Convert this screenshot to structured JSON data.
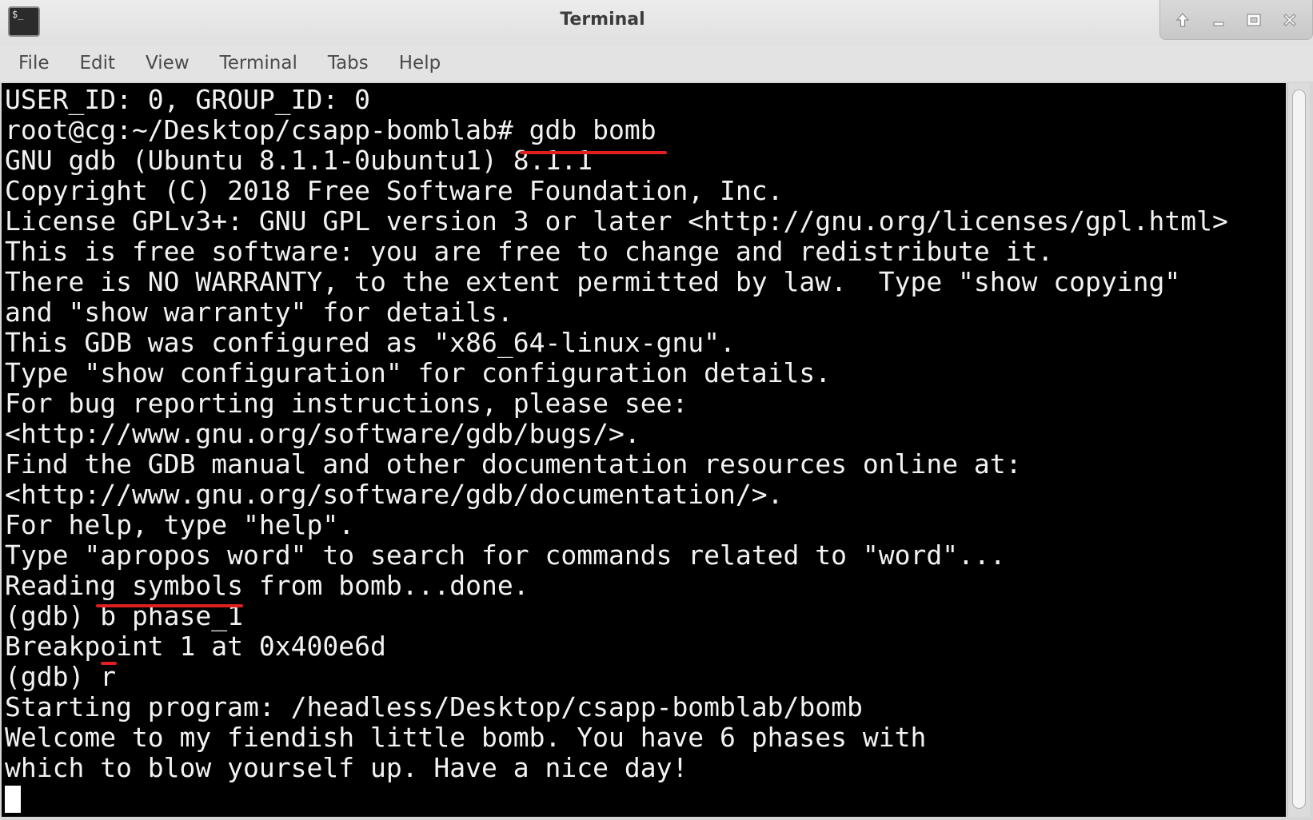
{
  "window": {
    "title": "Terminal",
    "app_icon_text": "$_"
  },
  "menu": [
    "File",
    "Edit",
    "View",
    "Terminal",
    "Tabs",
    "Help"
  ],
  "terminal": {
    "lines": [
      "USER_ID: 0, GROUP_ID: 0",
      "root@cg:~/Desktop/csapp-bomblab# gdb bomb",
      "GNU gdb (Ubuntu 8.1.1-0ubuntu1) 8.1.1",
      "Copyright (C) 2018 Free Software Foundation, Inc.",
      "License GPLv3+: GNU GPL version 3 or later <http://gnu.org/licenses/gpl.html>",
      "This is free software: you are free to change and redistribute it.",
      "There is NO WARRANTY, to the extent permitted by law.  Type \"show copying\"",
      "and \"show warranty\" for details.",
      "This GDB was configured as \"x86_64-linux-gnu\".",
      "Type \"show configuration\" for configuration details.",
      "For bug reporting instructions, please see:",
      "<http://www.gnu.org/software/gdb/bugs/>.",
      "Find the GDB manual and other documentation resources online at:",
      "<http://www.gnu.org/software/gdb/documentation/>.",
      "For help, type \"help\".",
      "Type \"apropos word\" to search for commands related to \"word\"...",
      "Reading symbols from bomb...done.",
      "(gdb) b phase_1",
      "Breakpoint 1 at 0x400e6d",
      "(gdb) r",
      "Starting program: /headless/Desktop/csapp-bomblab/bomb",
      "Welcome to my fiendish little bomb. You have 6 phases with",
      "which to blow yourself up. Have a nice day!"
    ]
  },
  "colors": {
    "terminal_bg": "#000000",
    "terminal_fg": "#f2f2f2",
    "annotation": "#e02020"
  }
}
